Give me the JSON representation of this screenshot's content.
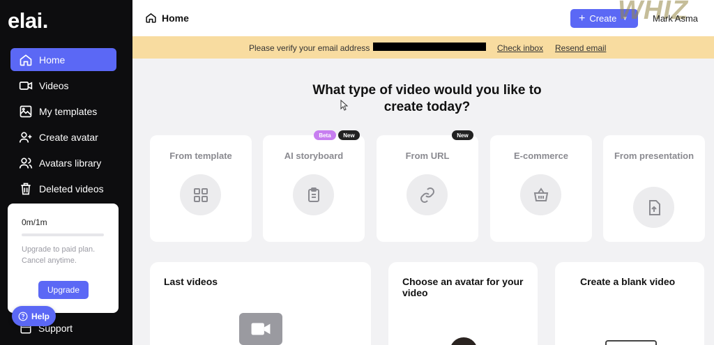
{
  "sidebar": {
    "logo": "elai.",
    "items": [
      {
        "label": "Home",
        "icon": "home-icon"
      },
      {
        "label": "Videos",
        "icon": "video-camera-icon"
      },
      {
        "label": "My templates",
        "icon": "templates-icon"
      },
      {
        "label": "Create avatar",
        "icon": "add-user-icon"
      },
      {
        "label": "Avatars library",
        "icon": "users-icon"
      },
      {
        "label": "Deleted videos",
        "icon": "trash-icon"
      }
    ],
    "plan": {
      "usage": "0m/1m",
      "progress_fraction": 0,
      "text": "Upgrade to paid plan. Cancel anytime.",
      "upgrade_label": "Upgrade"
    },
    "support_label": "Support",
    "help_label": "Help"
  },
  "header": {
    "breadcrumb": "Home",
    "create_label": "Create",
    "user_name": "Mark Asma",
    "watermark": "WHIZ"
  },
  "banner": {
    "text": "Please verify your email address",
    "check_inbox": "Check inbox",
    "resend_email": "Resend email"
  },
  "main": {
    "title": "What type of video would you like to create today?",
    "cards": [
      {
        "title": "From template",
        "icon": "grid-icon"
      },
      {
        "title": "AI storyboard",
        "icon": "clipboard-icon",
        "badges": [
          "Beta",
          "New"
        ]
      },
      {
        "title": "From URL",
        "icon": "link-icon",
        "badges": [
          "New"
        ]
      },
      {
        "title": "E-commerce",
        "icon": "basket-icon"
      },
      {
        "title": "From presentation",
        "icon": "file-upload-icon"
      }
    ],
    "bottom": [
      {
        "title": "Last videos"
      },
      {
        "title": "Choose an avatar for your video"
      },
      {
        "title": "Create a blank video"
      }
    ]
  },
  "colors": {
    "accent": "#5b68f5",
    "sidebar_bg": "#0d0d0f",
    "banner_bg": "#f8dca0",
    "beta_badge": "#c77ef0",
    "new_badge": "#222222"
  }
}
